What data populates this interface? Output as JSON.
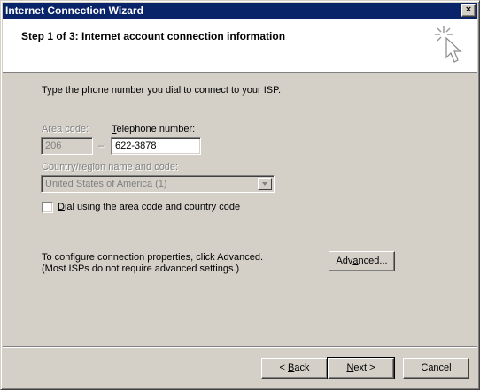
{
  "window": {
    "title": "Internet Connection Wizard",
    "close_label": "×"
  },
  "header": {
    "title": "Step 1 of 3: Internet account connection information",
    "icon": "wizard-sparkle-cursor-icon"
  },
  "form": {
    "instruction": "Type the phone number you dial to connect to your ISP.",
    "area_code_label": "Area code:",
    "area_code_value": "206",
    "dash": "–",
    "telephone_label_mnemonic": "T",
    "telephone_label_rest": "elephone number:",
    "telephone_value": "622-3878",
    "country_label": "Country/region name and code:",
    "country_value": "United States of America (1)",
    "dial_checkbox_mnemonic": "D",
    "dial_checkbox_rest": "ial using the area code and country code",
    "dial_checked": false,
    "advanced_note_line1": "To configure connection properties, click Advanced.",
    "advanced_note_line2": "(Most ISPs do not require advanced settings.)",
    "advanced_button_pre": "Adv",
    "advanced_button_mnemonic": "a",
    "advanced_button_post": "nced..."
  },
  "footer": {
    "back_arrow": "< ",
    "back_mnemonic": "B",
    "back_rest": "ack",
    "next_mnemonic": "N",
    "next_rest": "ext >",
    "cancel_label": "Cancel"
  },
  "colors": {
    "titlebar": "#0a246a",
    "face": "#d4d0c8",
    "header_bg": "#ffffff"
  }
}
